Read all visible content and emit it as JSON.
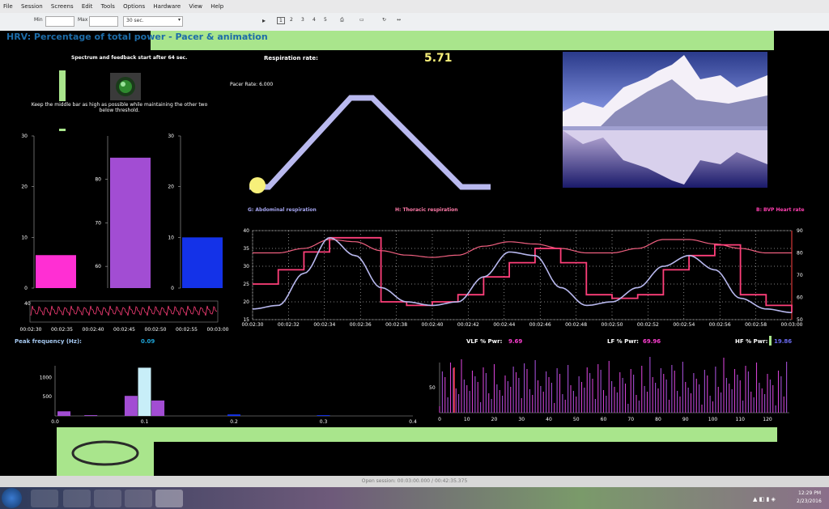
{
  "menu": [
    "File",
    "Session",
    "Screens",
    "Edit",
    "Tools",
    "Options",
    "Hardware",
    "View",
    "Help"
  ],
  "toolbar": {
    "min_label": "Min",
    "max_label": "Max",
    "duration": "30 sec.",
    "pages": [
      "1",
      "2",
      "3",
      "4",
      "5"
    ]
  },
  "screen_title": "HRV: Percentage of total power - Pacer  & animation",
  "spectrum_note": "Spectrum and feedback start after 64 sec.",
  "instruction": "Keep the middle bar as high as possible while maintaining the other two below threshold.",
  "respiration_label": "Respiration rate:",
  "respiration_value": "5.71",
  "pacer_rate": "Pacer Rate: 6.000",
  "channels": {
    "abdominal": "G: Abdominal respiration",
    "thoracic": "H: Thoracic respiration",
    "hr": "B: BVP Heart rate"
  },
  "colors": {
    "background": "#000000",
    "green": "#a9e58c",
    "magenta": "#ff2fd3",
    "purple": "#a24dd3",
    "blue": "#1432e8",
    "pink": "#ff3f7a",
    "lavender": "#b8b8ee",
    "pacer": "#b9b9ef",
    "ball": "#f7f07a",
    "cyan": "#1ea5d8"
  },
  "bars": {
    "left": {
      "ticks": [
        "30",
        "20",
        "10",
        "0"
      ],
      "value": 6.5
    },
    "middle": {
      "ticks": [
        "80",
        "70",
        "60"
      ],
      "value": 85
    },
    "right": {
      "ticks": [
        "30",
        "20",
        "10",
        "0"
      ],
      "value": 10
    }
  },
  "bvp_strip": {
    "ytick": "40",
    "times": [
      "00:02:30",
      "00:02:35",
      "00:02:40",
      "00:02:45",
      "00:02:50",
      "00:02:55",
      "00:03:00"
    ]
  },
  "main_chart": {
    "yleft": [
      "40",
      "35",
      "30",
      "25",
      "20",
      "15"
    ],
    "yright": [
      "90",
      "80",
      "70",
      "60",
      "50"
    ],
    "xticks": [
      "00:02:30",
      "00:02:32",
      "00:02:34",
      "00:02:36",
      "00:02:38",
      "00:02:40",
      "00:02:42",
      "00:02:44",
      "00:02:46",
      "00:02:48",
      "00:02:50",
      "00:02:52",
      "00:02:54",
      "00:02:56",
      "00:02:58",
      "00:03:00"
    ]
  },
  "peak": {
    "label": "Peak frequency (Hz):",
    "value": "0.09"
  },
  "powers": {
    "vlf_label": "VLF % Pwr:",
    "vlf": "9.69",
    "lf_label": "LF % Pwr:",
    "lf": "69.96",
    "hf_label": "HF % Pwr:",
    "hf": "19.86"
  },
  "spectrum": {
    "yticks": [
      "1000",
      "500"
    ],
    "xticks": [
      "0.0",
      "0.1",
      "0.2",
      "0.3",
      "0.4"
    ]
  },
  "hr_hist": {
    "ytick": "50",
    "xticks": [
      "0",
      "10",
      "20",
      "30",
      "40",
      "50",
      "60",
      "70",
      "80",
      "90",
      "100",
      "110",
      "120"
    ]
  },
  "status": "Open session: 00:03:00.000 / 00:42:35.375",
  "clock": {
    "time": "12:29 PM",
    "date": "2/23/2016"
  },
  "chart_data": [
    {
      "type": "bar",
      "categories": [
        "left",
        "middle",
        "right"
      ],
      "values": [
        6.5,
        85,
        10
      ]
    },
    {
      "type": "line",
      "x_ticks": [
        "00:02:30",
        "00:02:32",
        "00:02:34",
        "00:02:36",
        "00:02:38",
        "00:02:40",
        "00:02:42",
        "00:02:44",
        "00:02:46",
        "00:02:48",
        "00:02:50",
        "00:02:52",
        "00:02:54",
        "00:02:56",
        "00:02:58",
        "00:03:00"
      ],
      "series": [
        {
          "name": "G: Abdominal respiration",
          "axis": "left",
          "values": [
            18,
            19,
            28,
            38,
            33,
            24,
            20,
            19,
            20,
            27,
            34,
            33,
            24,
            19,
            20,
            24,
            30,
            33,
            29,
            21,
            18,
            17
          ]
        },
        {
          "name": "H: Thoracic respiration",
          "axis": "left",
          "values": [
            25,
            29,
            34,
            38,
            38,
            20,
            19,
            20,
            22,
            27,
            31,
            35,
            31,
            22,
            21,
            22,
            29,
            33,
            36,
            22,
            19,
            17
          ]
        },
        {
          "name": "B: BVP Heart rate",
          "axis": "right",
          "values": [
            80,
            80,
            82,
            86,
            85,
            81,
            79,
            78,
            79,
            83,
            85,
            84,
            82,
            80,
            80,
            82,
            86,
            86,
            84,
            82,
            80,
            80
          ]
        }
      ],
      "ylim_left": [
        15,
        40
      ],
      "ylim_right": [
        50,
        90
      ]
    },
    {
      "type": "bar",
      "title": "",
      "x": [
        0.01,
        0.04,
        0.085,
        0.1,
        0.115,
        0.2,
        0.3
      ],
      "values": [
        120,
        20,
        520,
        1250,
        400,
        40,
        20
      ],
      "xlim": [
        0,
        0.4
      ]
    }
  ]
}
